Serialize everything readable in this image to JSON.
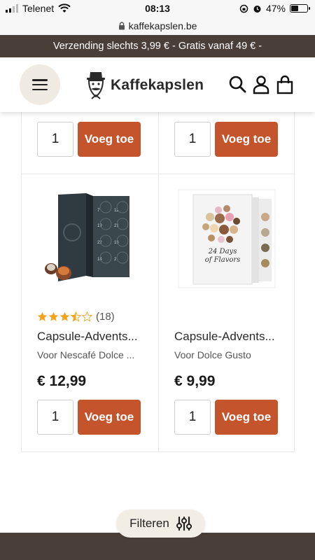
{
  "status_bar": {
    "carrier": "Telenet",
    "time": "08:13",
    "battery": "47%",
    "battery_level": 0.47
  },
  "url_bar": {
    "domain": "kaffekapslen.be"
  },
  "promo": {
    "text": "Verzending slechts 3,99 € - Gratis vanaf 49 € -"
  },
  "header": {
    "logo_text": "Kaffekapslen"
  },
  "top_row": [
    {
      "qty": "1",
      "add_label": "Voeg toe"
    },
    {
      "qty": "1",
      "add_label": "Voeg toe"
    }
  ],
  "products": [
    {
      "rating": 3.5,
      "review_count": "(18)",
      "name": "Capsule-Advents...",
      "subtitle": "Voor Nescafé Dolce ...",
      "price": "€ 12,99",
      "qty": "1",
      "add_label": "Voeg toe",
      "calendar_numbers": [
        "7",
        "11",
        "19",
        "21",
        "22",
        "16",
        "14",
        "2"
      ]
    },
    {
      "name": "Capsule-Advents...",
      "subtitle": "Voor Dolce Gusto",
      "price": "€ 9,99",
      "qty": "1",
      "add_label": "Voeg toe",
      "box_text_1": "24 Days",
      "box_text_2": "of Flavors"
    }
  ],
  "filter": {
    "label": "Filteren"
  },
  "colors": {
    "brand_dark": "#4a3e39",
    "accent": "#c4542c",
    "cream": "#f0ebe2",
    "star": "#f2a41c"
  }
}
